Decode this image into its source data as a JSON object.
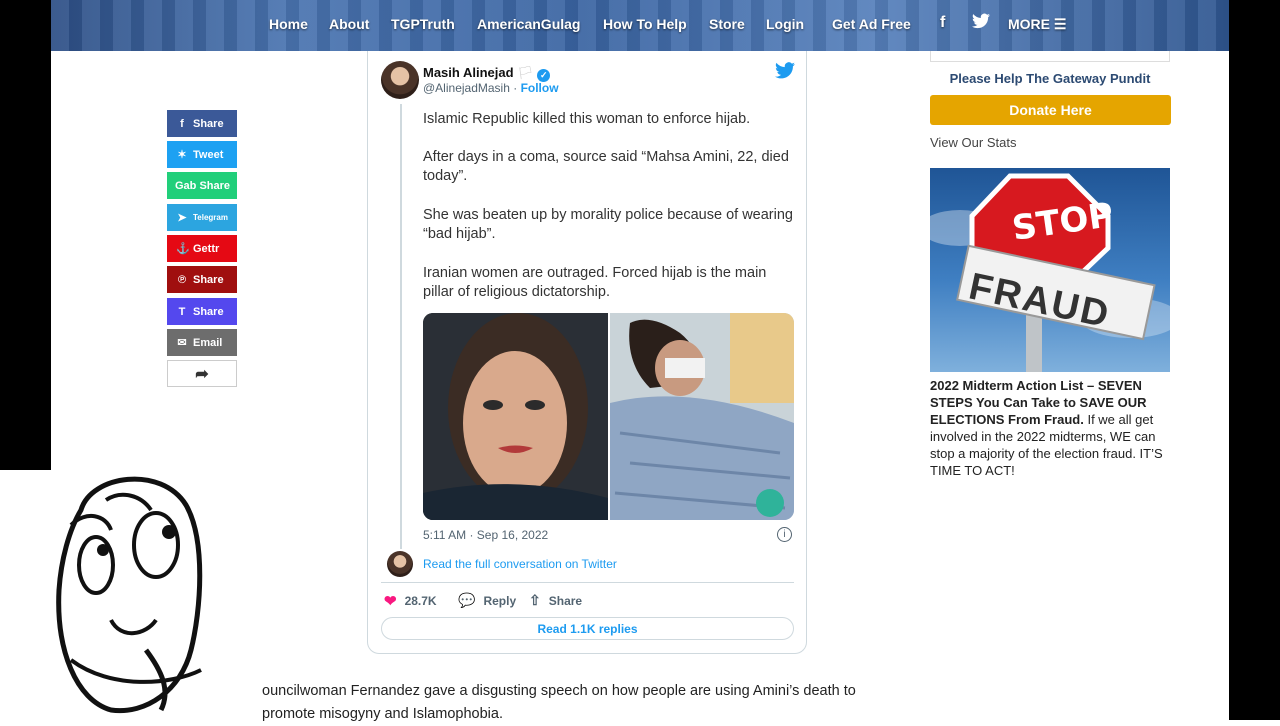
{
  "nav": {
    "items": [
      "Home",
      "About",
      "TGPTruth",
      "AmericanGulag",
      "How To Help",
      "Store",
      "Login",
      "Get Ad Free"
    ],
    "more_label": "MORE"
  },
  "share": {
    "buttons": [
      {
        "label": "Share",
        "icon": "facebook-icon",
        "color": "#3b5998"
      },
      {
        "label": "Tweet",
        "icon": "twitter-icon",
        "color": "#1da1f2"
      },
      {
        "label": "Gab Share",
        "icon": "gab-icon",
        "color": "#21cf7a"
      },
      {
        "label": "Telegram",
        "icon": "telegram-icon",
        "color": "#2ca5e0"
      },
      {
        "label": "Gettr",
        "icon": "gettr-icon",
        "color": "#e50914"
      },
      {
        "label": "Share",
        "icon": "parler-icon",
        "color": "#a00f0f"
      },
      {
        "label": "Share",
        "icon": "truth-icon",
        "color": "#5448ee"
      },
      {
        "label": "Email",
        "icon": "email-icon",
        "color": "#6d6d6d"
      }
    ]
  },
  "tweet": {
    "author_name": "Masih Alinejad",
    "author_handle": "@AlinejadMasih",
    "follow_label": "Follow",
    "paragraphs": [
      "Islamic Republic killed this woman to enforce hijab.",
      "After days in a coma, source said “Mahsa Amini, 22, died today”.",
      "She was beaten up by morality police because of wearing “bad hijab”.",
      "Iranian women are  outraged. Forced hijab is the main pillar of religious dictatorship."
    ],
    "timestamp": "5:11 AM · Sep 16, 2022",
    "read_conversation": "Read the full conversation on Twitter",
    "likes": "28.7K",
    "reply_label": "Reply",
    "share_label": "Share",
    "read_replies": "Read 1.1K replies"
  },
  "sidebar": {
    "help_text": "Please Help The Gateway Pundit",
    "donate_label": "Donate Here",
    "stats_link": "View Our Stats",
    "ad_stop": "STOP",
    "ad_fraud": "FRAUD",
    "ad_headline": "2022 Midterm Action List – SEVEN STEPS You Can Take to SAVE OUR ELECTIONS From Fraud.",
    "ad_body": " If we all get involved in the 2022 midterms, WE can stop a majority of the election fraud. IT’S TIME TO ACT!"
  },
  "article": {
    "line1": "ouncilwoman Fernandez gave a disgusting speech on how people are using Amini’s death to",
    "line2": "promote misogyny and Islamophobia."
  },
  "colors": {
    "twitter_blue": "#1d9bf0",
    "donate": "#e5a500",
    "nav_blue": "#3a64a2"
  }
}
